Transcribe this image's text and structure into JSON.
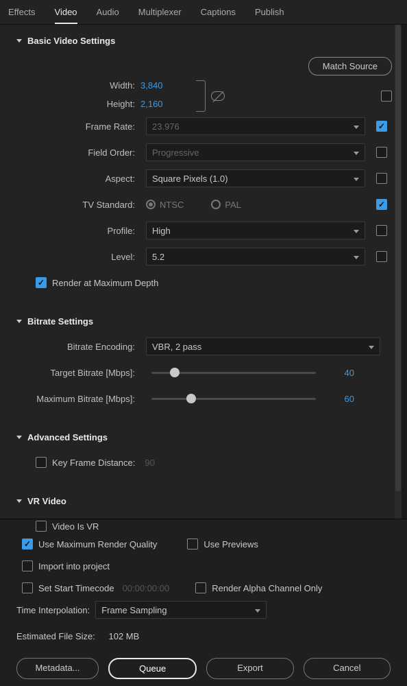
{
  "tabs": [
    "Effects",
    "Video",
    "Audio",
    "Multiplexer",
    "Captions",
    "Publish"
  ],
  "activeTab": 1,
  "matchSource": "Match Source",
  "sections": {
    "basic": {
      "title": "Basic Video Settings",
      "width": {
        "label": "Width:",
        "value": "3,840"
      },
      "height": {
        "label": "Height:",
        "value": "2,160"
      },
      "frameRate": {
        "label": "Frame Rate:",
        "value": "23.976"
      },
      "fieldOrder": {
        "label": "Field Order:",
        "value": "Progressive"
      },
      "aspect": {
        "label": "Aspect:",
        "value": "Square Pixels (1.0)"
      },
      "tvStd": {
        "label": "TV Standard:",
        "ntsc": "NTSC",
        "pal": "PAL"
      },
      "profile": {
        "label": "Profile:",
        "value": "High"
      },
      "level": {
        "label": "Level:",
        "value": "5.2"
      },
      "renderMax": "Render at Maximum Depth"
    },
    "bitrate": {
      "title": "Bitrate Settings",
      "encoding": {
        "label": "Bitrate Encoding:",
        "value": "VBR, 2 pass"
      },
      "target": {
        "label": "Target Bitrate [Mbps]:",
        "value": "40",
        "pos": 14
      },
      "max": {
        "label": "Maximum Bitrate [Mbps]:",
        "value": "60",
        "pos": 24
      }
    },
    "advanced": {
      "title": "Advanced Settings",
      "kfd": {
        "label": "Key Frame Distance:",
        "value": "90"
      }
    },
    "vr": {
      "title": "VR Video",
      "isVR": "Video Is VR"
    }
  },
  "bottom": {
    "maxQuality": "Use Maximum Render Quality",
    "usePreviews": "Use Previews",
    "importProj": "Import into project",
    "setStart": "Set Start Timecode",
    "startTC": "00:00:00:00",
    "alphaOnly": "Render Alpha Channel Only",
    "timeInterp": {
      "label": "Time Interpolation:",
      "value": "Frame Sampling"
    },
    "estSize": {
      "label": "Estimated File Size:",
      "value": "102 MB"
    },
    "buttons": {
      "metadata": "Metadata...",
      "queue": "Queue",
      "export": "Export",
      "cancel": "Cancel"
    }
  }
}
